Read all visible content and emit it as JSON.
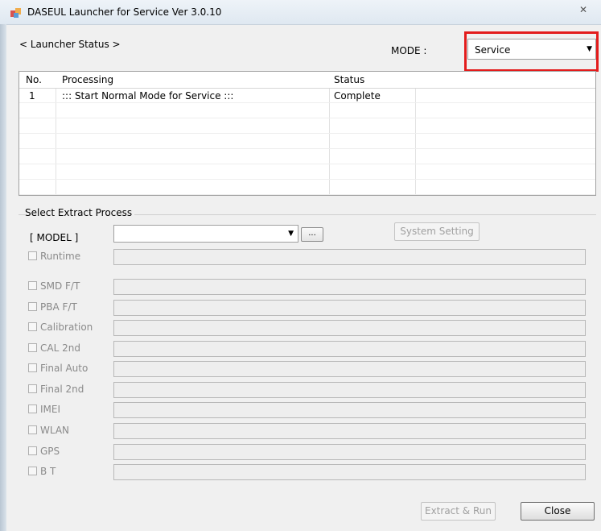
{
  "window": {
    "title": "DASEUL Launcher for Service Ver 3.0.10",
    "close_icon": "close-icon"
  },
  "status": {
    "heading": "< Launcher Status >"
  },
  "mode": {
    "label": "MODE :",
    "value": "Service"
  },
  "table": {
    "headers": [
      "No.",
      "Processing",
      "Status",
      ""
    ],
    "rows": [
      {
        "no": "1",
        "processing": "::: Start Normal Mode for Service :::",
        "status": "Complete"
      }
    ]
  },
  "extract": {
    "title": "Select Extract Process",
    "model_label": "[ MODEL ]",
    "model_value": "",
    "browse_label": "...",
    "system_setting_label": "System Setting",
    "options": [
      {
        "label": "Runtime",
        "checked": false,
        "value": ""
      },
      {
        "label": "SMD F/T",
        "checked": false,
        "value": ""
      },
      {
        "label": "PBA F/T",
        "checked": false,
        "value": ""
      },
      {
        "label": "Calibration",
        "checked": false,
        "value": ""
      },
      {
        "label": "CAL 2nd",
        "checked": false,
        "value": ""
      },
      {
        "label": "Final Auto",
        "checked": false,
        "value": ""
      },
      {
        "label": "Final 2nd",
        "checked": false,
        "value": ""
      },
      {
        "label": "IMEI",
        "checked": false,
        "value": ""
      },
      {
        "label": "WLAN",
        "checked": false,
        "value": ""
      },
      {
        "label": "GPS",
        "checked": false,
        "value": ""
      },
      {
        "label": "B T",
        "checked": false,
        "value": ""
      }
    ]
  },
  "footer": {
    "extract_run_label": "Extract & Run",
    "close_label": "Close"
  },
  "colors": {
    "highlight": "#e31c1c",
    "window_bg": "#f0f0f0"
  }
}
